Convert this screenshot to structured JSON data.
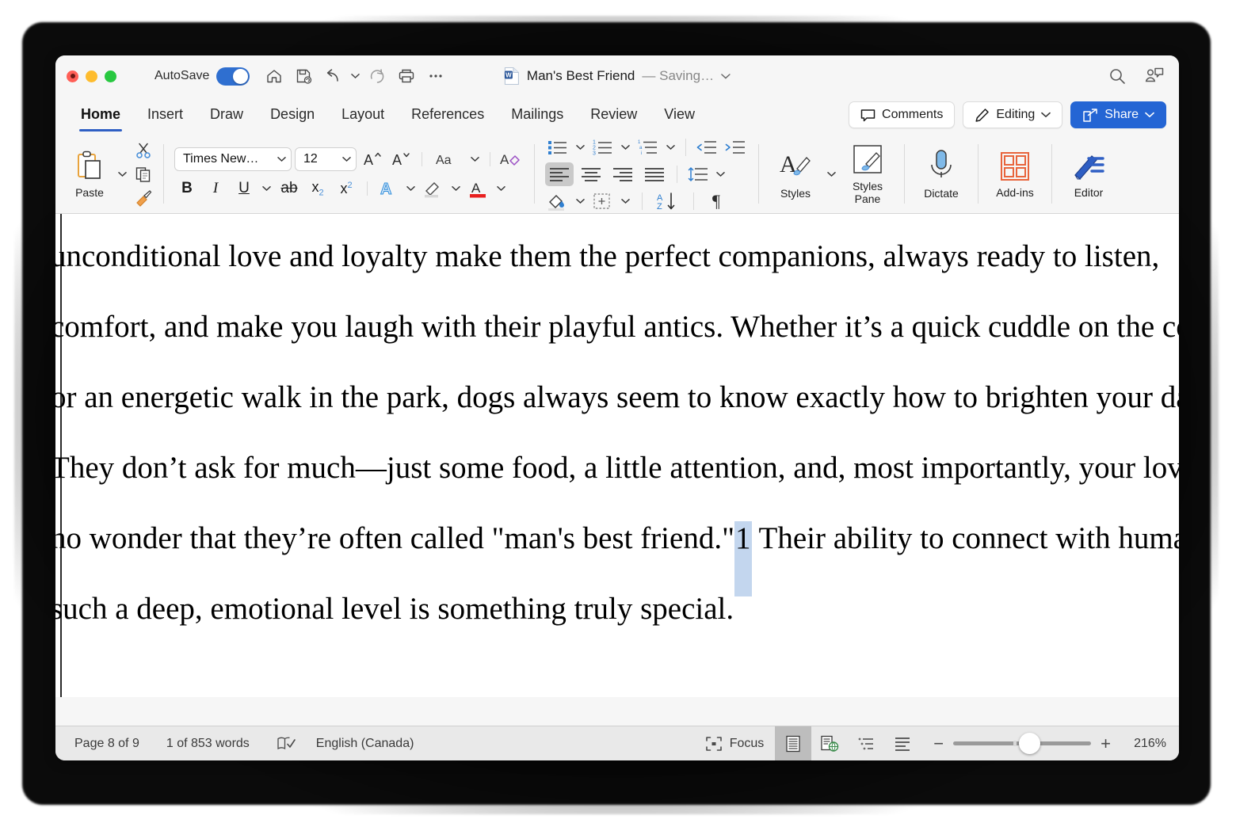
{
  "window": {
    "traffic_lights": [
      "close",
      "minimize",
      "maximize"
    ],
    "autosave_label": "AutoSave",
    "autosave_state": "on",
    "doc_title": "Man's Best Friend",
    "doc_state": "— Saving…",
    "quick_access": [
      {
        "name": "home-icon",
        "label": "Home"
      },
      {
        "name": "save-icon",
        "label": "Save"
      },
      {
        "name": "undo-icon",
        "label": "Undo"
      },
      {
        "name": "redo-icon",
        "label": "Redo"
      },
      {
        "name": "print-icon",
        "label": "Print"
      },
      {
        "name": "more-icon",
        "label": "More"
      }
    ],
    "title_right": [
      {
        "name": "search-icon",
        "label": "Search"
      },
      {
        "name": "collaborators-icon",
        "label": "Collaborators"
      }
    ]
  },
  "tabs": [
    {
      "label": "Home",
      "active": true
    },
    {
      "label": "Insert",
      "active": false
    },
    {
      "label": "Draw",
      "active": false
    },
    {
      "label": "Design",
      "active": false
    },
    {
      "label": "Layout",
      "active": false
    },
    {
      "label": "References",
      "active": false
    },
    {
      "label": "Mailings",
      "active": false
    },
    {
      "label": "Review",
      "active": false
    },
    {
      "label": "View",
      "active": false
    }
  ],
  "tab_actions": {
    "comments": "Comments",
    "editing": "Editing",
    "share": "Share"
  },
  "ribbon": {
    "paste_label": "Paste",
    "clipboard_tools": [
      "cut",
      "copy",
      "format-painter"
    ],
    "font_name": "Times New…",
    "font_size": "12",
    "font_tools": [
      "grow-font",
      "shrink-font",
      "change-case",
      "clear-formatting",
      "bold",
      "italic",
      "underline",
      "strikethrough",
      "subscript",
      "superscript",
      "text-effects",
      "highlight-color",
      "font-color"
    ],
    "paragraph_tools": [
      "bullets",
      "numbering",
      "multilevel-list",
      "decrease-indent",
      "increase-indent",
      "align-left",
      "align-center",
      "align-right",
      "justify",
      "line-spacing",
      "shading",
      "borders",
      "sort",
      "show-formatting"
    ],
    "big_buttons": [
      {
        "label": "Styles",
        "icon": "styles-icon",
        "caret": true
      },
      {
        "label": "Styles\nPane",
        "icon": "styles-pane-icon",
        "caret": false
      },
      {
        "label": "Dictate",
        "icon": "microphone-icon",
        "caret": false
      },
      {
        "label": "Add-ins",
        "icon": "addins-icon",
        "caret": false
      },
      {
        "label": "Editor",
        "icon": "editor-icon",
        "caret": false
      }
    ],
    "styles_label": "Styles",
    "styles_pane_label_1": "Styles",
    "styles_pane_label_2": "Pane",
    "dictate_label": "Dictate",
    "addins_label": "Add-ins",
    "editor_label": "Editor"
  },
  "document": {
    "font": "Times New Roman",
    "lines": [
      "unconditional love and loyalty make them the perfect companions, always ready to listen,",
      "comfort, and make you laugh with their playful antics. Whether it’s a quick cuddle on the cou",
      "or an energetic walk in the park, dogs always seem to know exactly how to brighten your day",
      "They don’t ask for much—just some food, a little attention, and, most importantly, your love",
      "no wonder that they’re often called \"man's best friend.\"",
      "such a deep, emotional level is something truly special."
    ],
    "footnote_line_prefix": "no wonder that they’re often called \"man's best friend.\"",
    "footnote_marker": "1",
    "footnote_line_suffix": " Their ability to connect with human",
    "selection_color": "#c3d6ee"
  },
  "statusbar": {
    "page": "Page 8 of 9",
    "words": "1 of 853 words",
    "proofing_icon": "spell-check-icon",
    "language": "English (Canada)",
    "focus": "Focus",
    "views": [
      {
        "name": "print-layout-view",
        "selected": true
      },
      {
        "name": "web-layout-view",
        "selected": false
      },
      {
        "name": "outline-view",
        "selected": false
      },
      {
        "name": "draft-view",
        "selected": false
      }
    ],
    "zoom_minus": "−",
    "zoom_plus": "+",
    "zoom_percent": "216%"
  },
  "colors": {
    "accent_blue": "#2465d4",
    "tab_underline": "#2f5fc4",
    "toggle_on": "#2f6fd0",
    "selection": "#c3d6ee",
    "window_chrome": "#f6f6f6",
    "statusbar": "#e9e9e9"
  }
}
